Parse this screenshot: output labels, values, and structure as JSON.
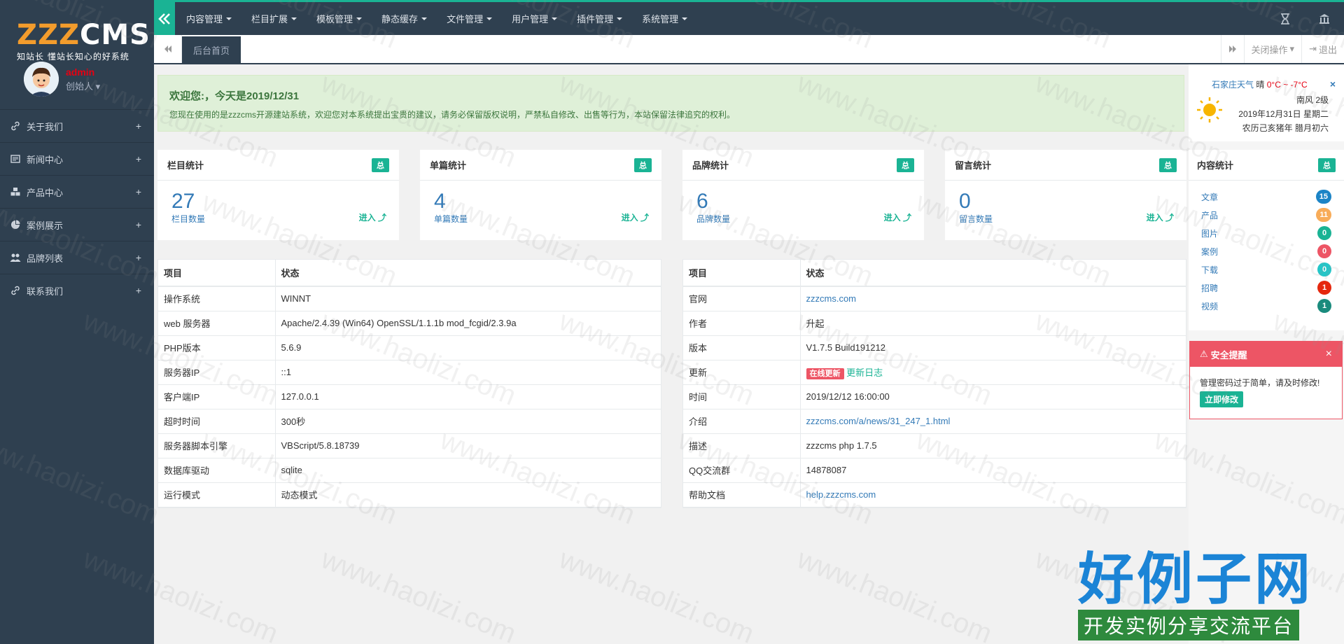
{
  "brand": {
    "logo_z": "ZZZ",
    "logo_c": "CMS",
    "slogan": "知站长 懂站长知心的好系统"
  },
  "user": {
    "name": "admin",
    "role": "创始人"
  },
  "sidebar": {
    "items": [
      {
        "label": "关于我们",
        "icon": "link-icon"
      },
      {
        "label": "新闻中心",
        "icon": "newspaper-icon"
      },
      {
        "label": "产品中心",
        "icon": "cubes-icon"
      },
      {
        "label": "案例展示",
        "icon": "pie-chart-icon"
      },
      {
        "label": "品牌列表",
        "icon": "users-icon"
      },
      {
        "label": "联系我们",
        "icon": "link-icon"
      }
    ],
    "plus": "+"
  },
  "topnav": {
    "menus": [
      "内容管理",
      "栏目扩展",
      "模板管理",
      "静态缓存",
      "文件管理",
      "用户管理",
      "插件管理",
      "系统管理"
    ]
  },
  "tabs": {
    "home": "后台首页",
    "close_ops": "关闭操作",
    "logout": "退出"
  },
  "welcome": {
    "title": "欢迎您:，今天是2019/12/31",
    "text": "您现在使用的是zzzcms开源建站系统，欢迎您对本系统提出宝贵的建议，请务必保留版权说明，严禁私自修改、出售等行为，本站保留法律追究的权利。"
  },
  "stats": [
    {
      "title": "栏目统计",
      "badge": "总",
      "value": "27",
      "label": "栏目数量",
      "link": "进入"
    },
    {
      "title": "单篇统计",
      "badge": "总",
      "value": "4",
      "label": "单篇数量",
      "link": "进入"
    },
    {
      "title": "品牌统计",
      "badge": "总",
      "value": "6",
      "label": "品牌数量",
      "link": "进入"
    },
    {
      "title": "留言统计",
      "badge": "总",
      "value": "0",
      "label": "留言数量",
      "link": "进入"
    }
  ],
  "server_table": {
    "headers": [
      "项目",
      "状态"
    ],
    "rows": [
      [
        "操作系统",
        "WINNT"
      ],
      [
        "web 服务器",
        "Apache/2.4.39 (Win64) OpenSSL/1.1.1b mod_fcgid/2.3.9a"
      ],
      [
        "PHP版本",
        "5.6.9"
      ],
      [
        "服务器IP",
        "::1"
      ],
      [
        "客户端IP",
        "127.0.0.1"
      ],
      [
        "超时时间",
        "300秒"
      ],
      [
        "服务器脚本引擎",
        "VBScript/5.8.18739"
      ],
      [
        "数据库驱动",
        "sqlite"
      ],
      [
        "运行模式",
        "动态模式"
      ]
    ]
  },
  "info_table": {
    "headers": [
      "项目",
      "状态"
    ],
    "rows": [
      {
        "k": "官网",
        "v": "zzzcms.com",
        "link": true
      },
      {
        "k": "作者",
        "v": "升起"
      },
      {
        "k": "版本",
        "v": "V1.7.5 Build191212"
      },
      {
        "k": "更新",
        "tag": "在线更新",
        "v": "更新日志"
      },
      {
        "k": "时间",
        "v": "2019/12/12 16:00:00"
      },
      {
        "k": "介绍",
        "v": "zzzcms.com/a/news/31_247_1.html",
        "link": true
      },
      {
        "k": "描述",
        "v": "zzzcms php 1.7.5"
      },
      {
        "k": "QQ交流群",
        "v": "14878087"
      },
      {
        "k": "帮助文档",
        "v": "help.zzzcms.com",
        "link": true
      }
    ]
  },
  "weather": {
    "city": "石家庄天气",
    "cond": "晴",
    "temp": "0°C ~ -7°C",
    "wind": "南风 2级",
    "date": "2019年12月31日 星期二",
    "lunar": "农历己亥猪年 腊月初六",
    "close": "×"
  },
  "content_stats": {
    "title": "内容统计",
    "badge": "总",
    "items": [
      {
        "label": "文章",
        "count": "15",
        "color": "#1c84c6"
      },
      {
        "label": "产品",
        "count": "11",
        "color": "#f8ac59"
      },
      {
        "label": "图片",
        "count": "0",
        "color": "#1ab394"
      },
      {
        "label": "案例",
        "count": "0",
        "color": "#ed5565"
      },
      {
        "label": "下载",
        "count": "0",
        "color": "#23c6c8"
      },
      {
        "label": "招聘",
        "count": "1",
        "color": "#e5280e"
      },
      {
        "label": "视频",
        "count": "1",
        "color": "#1a8b7d"
      }
    ]
  },
  "alert": {
    "title": "安全提醒",
    "text": "管理密码过于简单，请及时修改!",
    "button": "立即修改",
    "close": "×"
  },
  "watermark": {
    "text": "www.haolizi.com",
    "logo_big": "好例子网",
    "logo_sub": "开发实例分享交流平台"
  }
}
